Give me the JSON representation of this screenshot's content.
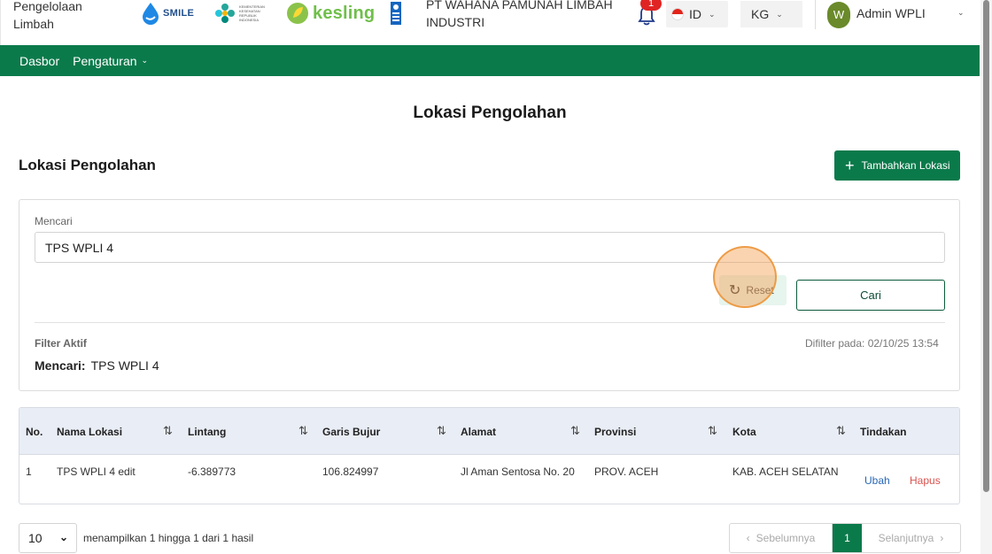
{
  "header": {
    "app_name": "Pengelolaan Limbah",
    "logos": {
      "smile": "SMILE",
      "kemkes": "KEMENTERIAN KESEHATAN REPUBLIK INDONESIA",
      "kesling": "kesling"
    },
    "company": "PT WAHANA PAMUNAH LIMBAH INDUSTRI",
    "notification_count": "1",
    "language": "ID",
    "unit": "KG",
    "avatar_initial": "W",
    "user_name": "Admin WPLI"
  },
  "nav": {
    "items": [
      {
        "label": "Dasbor"
      },
      {
        "label": "Pengaturan"
      }
    ]
  },
  "page": {
    "title": "Lokasi Pengolahan",
    "section_title": "Lokasi Pengolahan",
    "add_button": "Tambahkan Lokasi"
  },
  "search": {
    "label": "Mencari",
    "value": "TPS WPLI 4",
    "reset_button": "Reset",
    "search_button": "Cari",
    "active_filter_label": "Filter Aktif",
    "filtered_at": "Difilter pada: 02/10/25 13:54",
    "active_filter_key": "Mencari:",
    "active_filter_value": "TPS WPLI 4"
  },
  "table": {
    "headers": [
      "No.",
      "Nama Lokasi",
      "Lintang",
      "Garis Bujur",
      "Alamat",
      "Provinsi",
      "Kota",
      "Tindakan"
    ],
    "rows": [
      {
        "no": "1",
        "nama": "TPS WPLI 4 edit",
        "lintang": "-6.389773",
        "bujur": "106.824997",
        "alamat": "Jl Aman Sentosa No. 20",
        "provinsi": "PROV. ACEH",
        "kota": "KAB. ACEH SELATAN",
        "edit": "Ubah",
        "delete": "Hapus"
      }
    ]
  },
  "footer": {
    "page_size": "10",
    "showing": "menampilkan 1 hingga 1 dari 1 hasil",
    "prev": "Sebelumnya",
    "current_page": "1",
    "next": "Selanjutnya"
  },
  "colors": {
    "primary": "#0b7a4b",
    "header_bg": "#e9edf5",
    "danger": "#d9534f",
    "link": "#2867b2"
  }
}
